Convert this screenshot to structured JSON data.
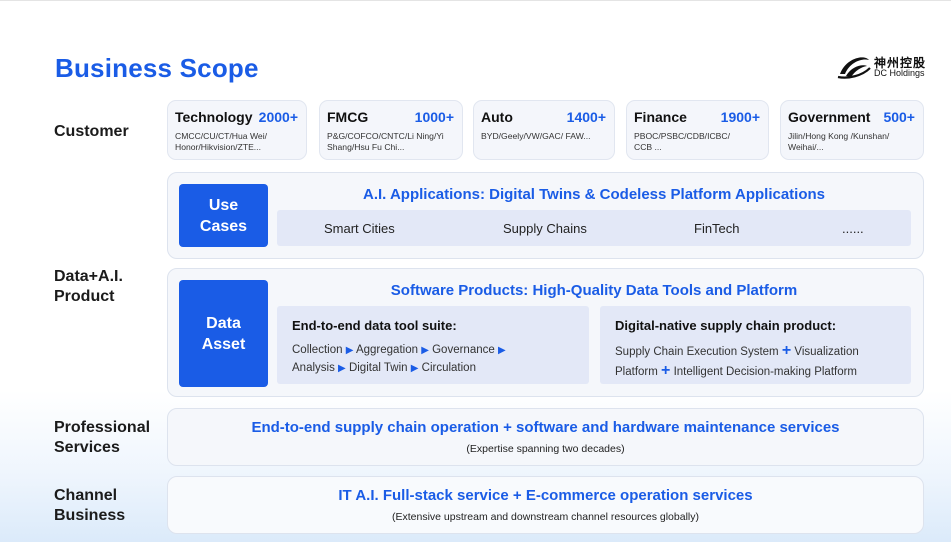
{
  "title": "Business Scope",
  "logo": {
    "cn": "神州控股",
    "en": "DC Holdings"
  },
  "labels": {
    "customer": "Customer",
    "data_ai_1": "Data+A.I.",
    "data_ai_2": "Product",
    "professional_1": "Professional",
    "professional_2": "Services",
    "channel_1": "Channel",
    "channel_2": "Business"
  },
  "customers": [
    {
      "name": "Technology",
      "count": "2000+",
      "desc1": "CMCC/CU/CT/Hua Wei/",
      "desc2": "Honor/Hikvision/ZTE..."
    },
    {
      "name": "FMCG",
      "count": "1000+",
      "desc1": "P&G/COFCO/CNTC/Li Ning/Yi",
      "desc2": "Shang/Hsu Fu Chi..."
    },
    {
      "name": "Auto",
      "count": "1400+",
      "desc1": "BYD/Geely/VW/GAC/ FAW...",
      "desc2": ""
    },
    {
      "name": "Finance",
      "count": "1900+",
      "desc1": "PBOC/PSBC/CDB/ICBC/",
      "desc2": "CCB ..."
    },
    {
      "name": "Government",
      "count": "500+",
      "desc1": "Jilin/Hong Kong /Kunshan/",
      "desc2": "Weihai/..."
    }
  ],
  "use_cases": {
    "box_1": "Use",
    "box_2": "Cases",
    "heading": "A.I. Applications: Digital Twins & Codeless Platform Applications",
    "items": [
      "Smart Cities",
      "Supply Chains",
      "FinTech",
      "......"
    ]
  },
  "data_asset": {
    "box_1": "Data",
    "box_2": "Asset",
    "heading": "Software Products: High-Quality Data Tools and Platform",
    "left": {
      "title": "End-to-end data tool suite:",
      "steps": [
        "Collection",
        "Aggregation",
        "Governance",
        "Analysis",
        "Digital Twin",
        "Circulation"
      ]
    },
    "right": {
      "title": "Digital-native supply chain product:",
      "line1_a": "Supply Chain Execution System",
      "line1_b": "Visualization",
      "line2_a": "Platform",
      "line2_b": "Intelligent Decision-making Platform"
    }
  },
  "professional": {
    "heading": "End-to-end supply chain operation + software and hardware maintenance services",
    "sub": "(Expertise spanning two decades)"
  },
  "channel": {
    "heading": "IT A.I. Full-stack service + E-commerce operation services",
    "sub": "(Extensive upstream and downstream channel resources globally)"
  },
  "colors": {
    "accent": "#1a5ce6",
    "panel": "#f5f7fb",
    "strip": "#e3e8f7"
  }
}
